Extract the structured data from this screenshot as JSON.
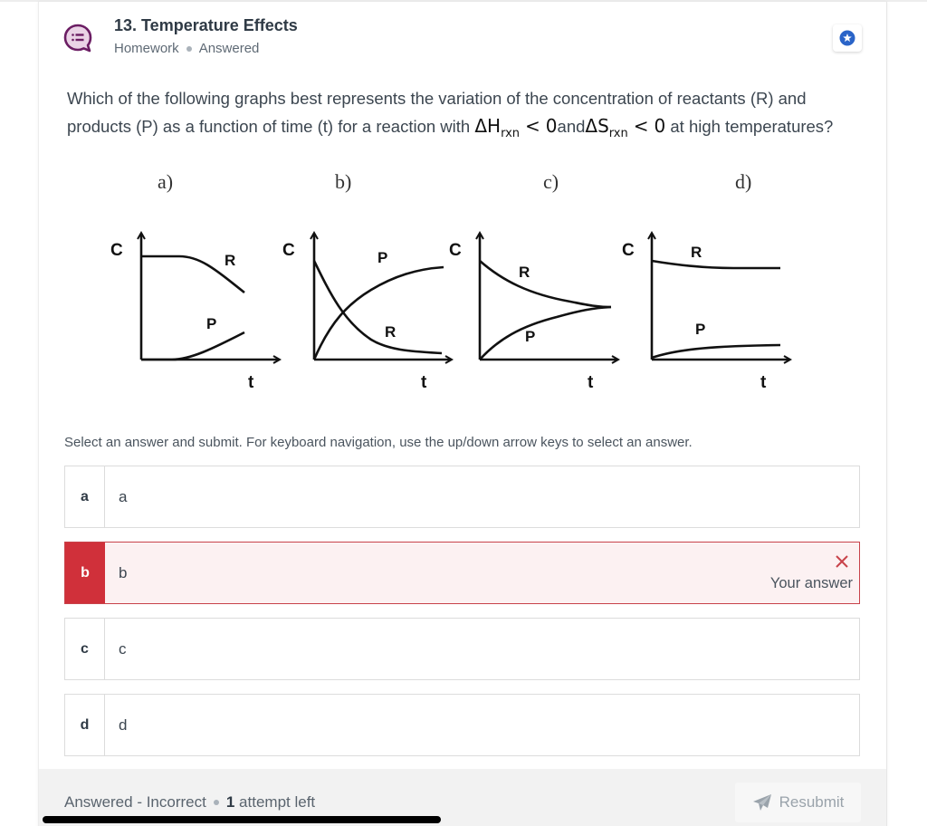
{
  "header": {
    "title": "13. Temperature Effects",
    "type": "Homework",
    "status": "Answered",
    "icon": "question-bubble-icon",
    "bookmark_icon": "star-icon",
    "accent_color": "#6b1d63",
    "bookmark_color": "#2a64c8"
  },
  "question": {
    "part1": "Which of the following graphs best represents the variation of the concentration of reactants (R) and products (P) as a function of time (t) for a reaction with",
    "dh_symbol": "ΔH",
    "dh_sub": "rxn",
    "lt": "<",
    "zero": "0",
    "and": "and",
    "ds_symbol": "ΔS",
    "ds_sub": "rxn",
    "part2": "at high temperatures?"
  },
  "graphs": [
    {
      "label": "a)",
      "yaxis": "C",
      "xaxis": "t",
      "curve1": "R",
      "curve2": "P",
      "description": "R starts high, stays flat then decreases; P starts at zero and increases slowly"
    },
    {
      "label": "b)",
      "yaxis": "C",
      "xaxis": "t",
      "curve1": "P",
      "curve2": "R",
      "description": "R decays from high to near zero; P rises from zero to high; curves cross"
    },
    {
      "label": "c)",
      "yaxis": "C",
      "xaxis": "t",
      "curve1": "R",
      "curve2": "P",
      "description": "R decreases and P increases, both converging to the same value"
    },
    {
      "label": "d)",
      "yaxis": "C",
      "xaxis": "t",
      "curve1": "R",
      "curve2": "P",
      "description": "R stays high with slight decrease; P stays low with slight increase"
    }
  ],
  "instructions": "Select an answer and submit. For keyboard navigation, use the up/down arrow keys to select an answer.",
  "options": [
    {
      "key": "a",
      "label": "a",
      "state": "default"
    },
    {
      "key": "b",
      "label": "b",
      "state": "incorrect",
      "result_icon": "x-icon",
      "result_text": "Your answer"
    },
    {
      "key": "c",
      "label": "c",
      "state": "default"
    },
    {
      "key": "d",
      "label": "d",
      "state": "default"
    }
  ],
  "footer": {
    "status": "Answered - Incorrect",
    "attempts_count": "1",
    "attempts_text": "attempt left",
    "resubmit_label": "Resubmit",
    "resubmit_icon": "paper-plane-icon"
  },
  "colors": {
    "incorrect": "#d0303a",
    "incorrect_bg": "#fcf1f2",
    "footer_bg": "#f2f2f2"
  }
}
